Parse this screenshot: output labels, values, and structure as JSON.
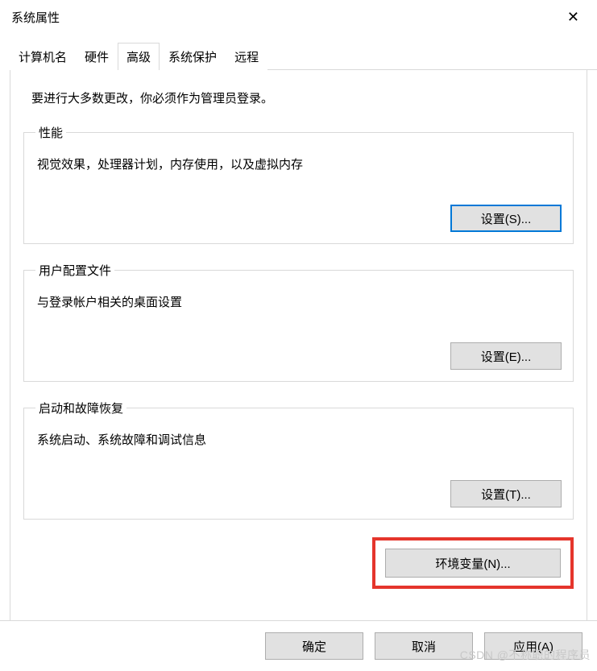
{
  "dialog": {
    "title": "系统属性"
  },
  "tabs": {
    "computer_name": "计算机名",
    "hardware": "硬件",
    "advanced": "高级",
    "system_protection": "系统保护",
    "remote": "远程"
  },
  "content": {
    "intro": "要进行大多数更改，你必须作为管理员登录。",
    "performance": {
      "legend": "性能",
      "desc": "视觉效果，处理器计划，内存使用，以及虚拟内存",
      "button": "设置(S)..."
    },
    "user_profiles": {
      "legend": "用户配置文件",
      "desc": "与登录帐户相关的桌面设置",
      "button": "设置(E)..."
    },
    "startup": {
      "legend": "启动和故障恢复",
      "desc": "系统启动、系统故障和调试信息",
      "button": "设置(T)..."
    },
    "env_button": "环境变量(N)..."
  },
  "buttons": {
    "ok": "确定",
    "cancel": "取消",
    "apply": "应用(A)"
  },
  "watermark": "CSDN @不称职的程序员"
}
